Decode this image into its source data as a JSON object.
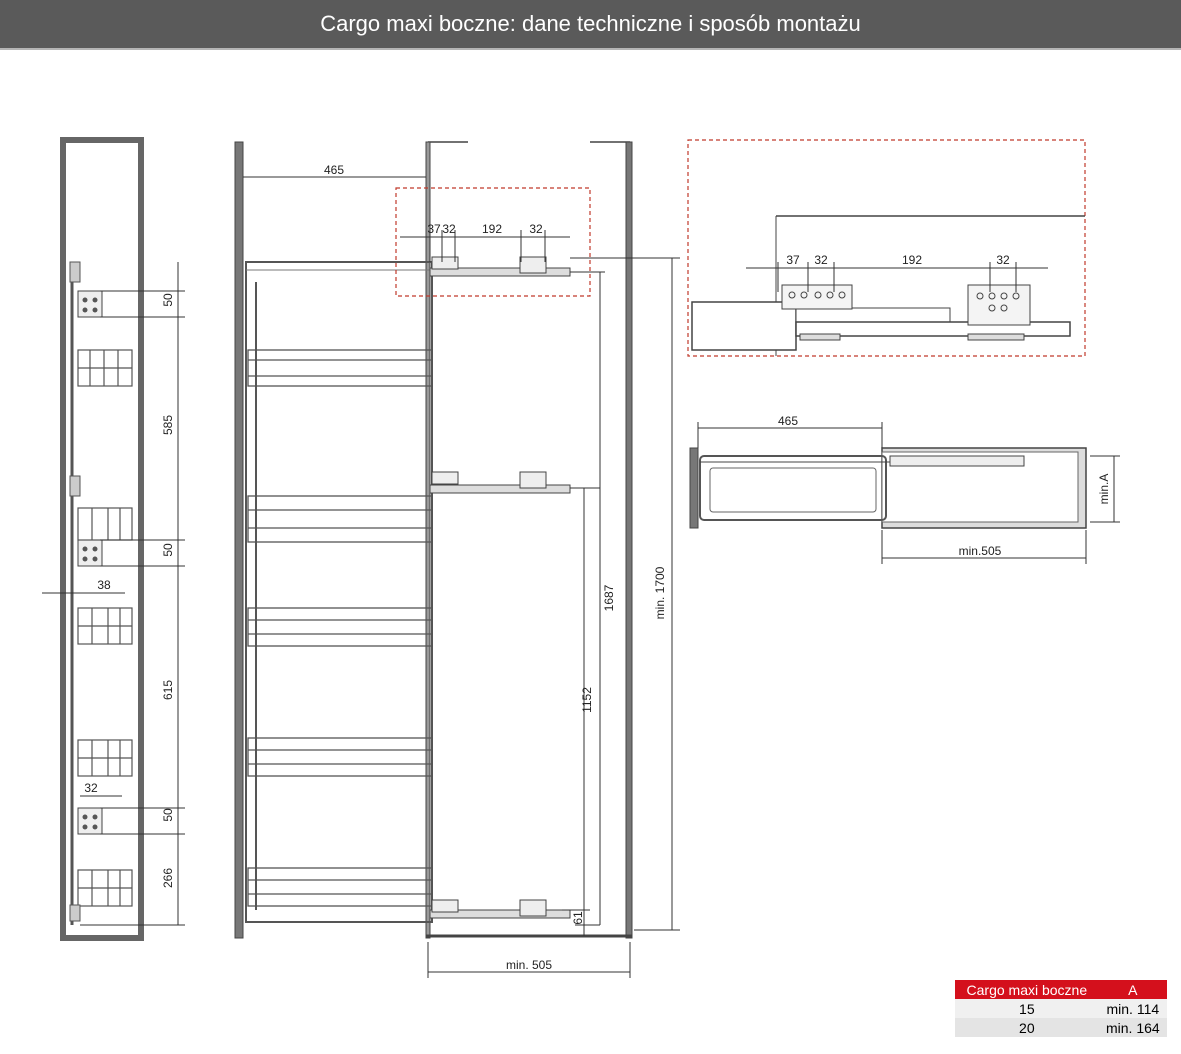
{
  "header": {
    "title": "Cargo maxi boczne: dane techniczne i sposób montażu"
  },
  "side_view": {
    "dims": {
      "d50a": "50",
      "d585": "585",
      "d50b": "50",
      "d38": "38",
      "d615": "615",
      "d32": "32",
      "d50c": "50",
      "d266": "266"
    }
  },
  "front_view": {
    "dims": {
      "d465": "465",
      "d37": "37",
      "d32a": "32",
      "d192": "192",
      "d32b": "32",
      "d1687": "1687",
      "d1152": "1152",
      "d61": "61",
      "dmin1700": "min. 1700",
      "dmin505": "min. 505"
    }
  },
  "detail_view": {
    "dims": {
      "d37": "37",
      "d32a": "32",
      "d192": "192",
      "d32b": "32"
    }
  },
  "top_view": {
    "dims": {
      "d465": "465",
      "dmin505": "min.505",
      "dminA": "min.A"
    }
  },
  "table": {
    "header_col1": "Cargo maxi boczne",
    "header_col2": "A",
    "rows": [
      {
        "size": "15",
        "a": "min. 114"
      },
      {
        "size": "20",
        "a": "min. 164"
      }
    ]
  },
  "colors": {
    "header_bg": "#5a5a5a",
    "accent_red": "#d4101c",
    "frame_gray": "#6a6a6a",
    "dashed_red": "#c0392b"
  }
}
